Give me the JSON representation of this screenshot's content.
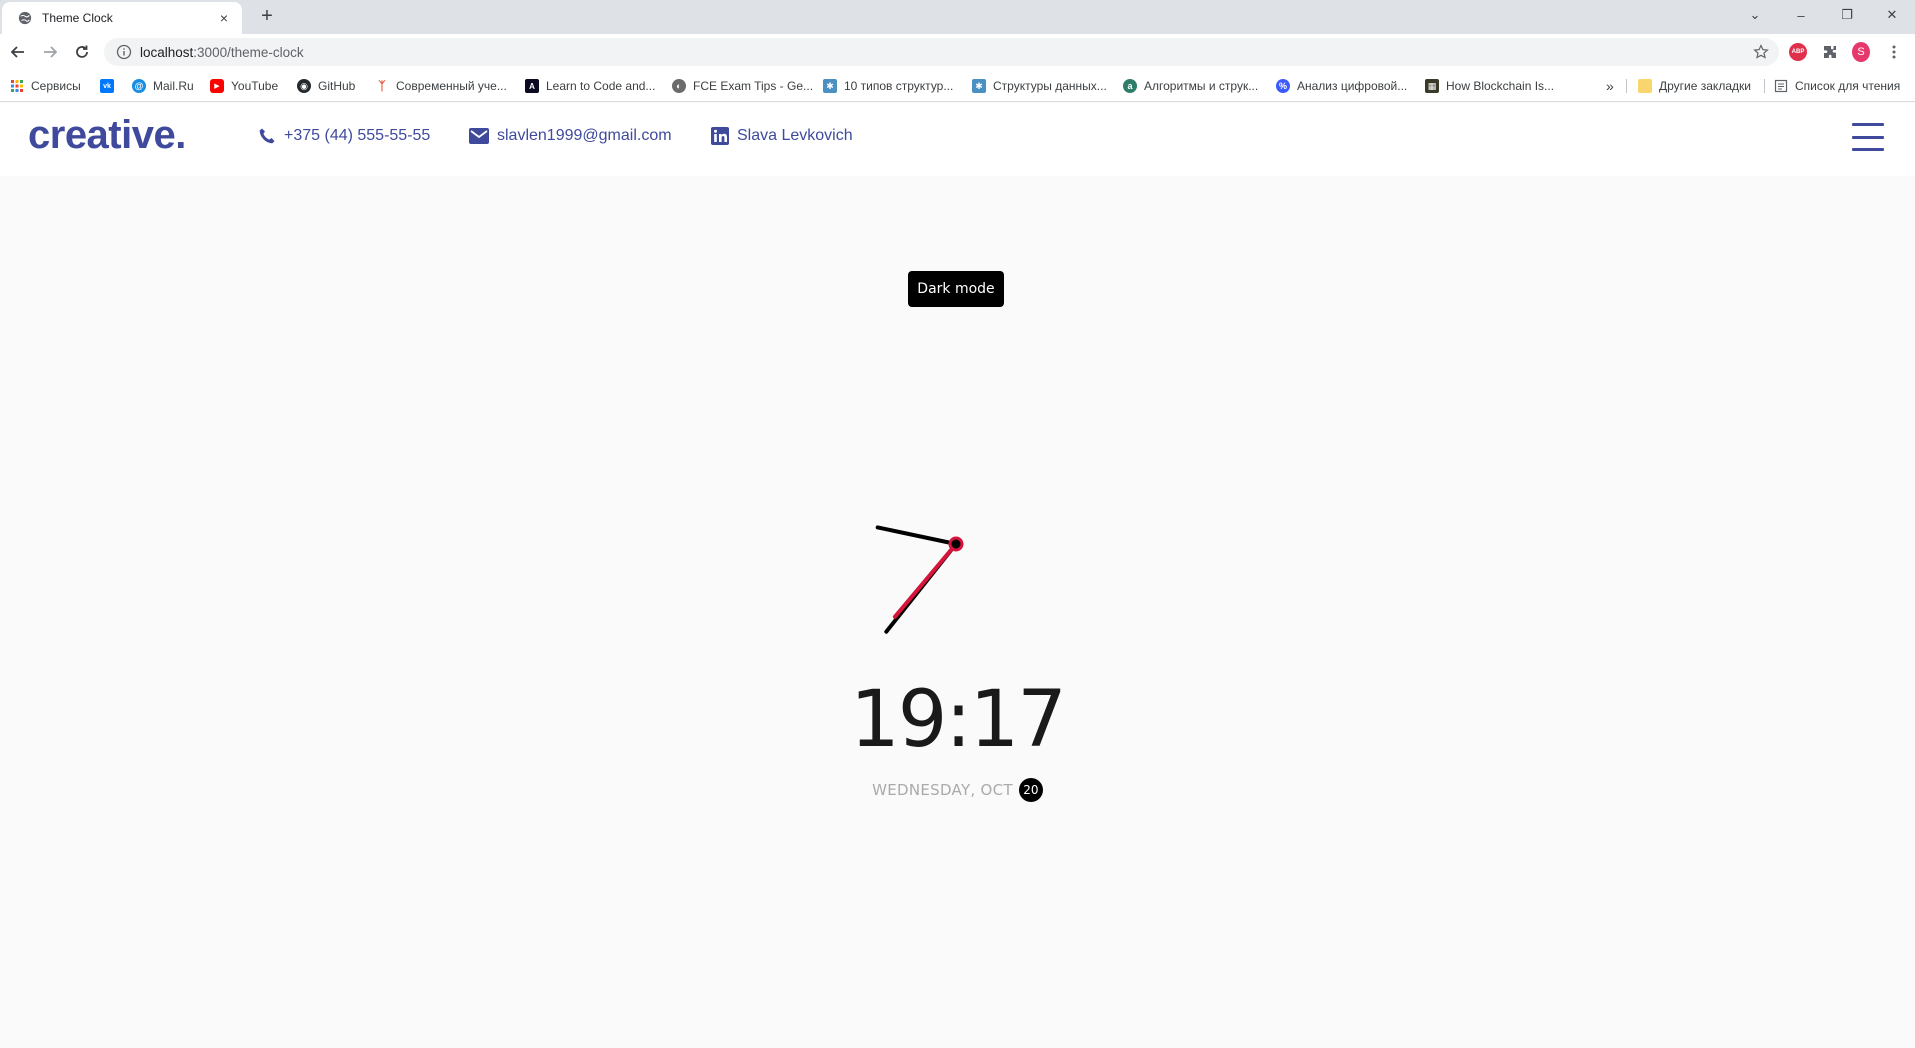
{
  "browser": {
    "tab": {
      "title": "Theme Clock",
      "close_glyph": "×",
      "favicon": "globe-icon"
    },
    "new_tab_glyph": "+",
    "window_controls": {
      "tab_search": "⌄",
      "minimize": "–",
      "restore": "❐",
      "close": "✕"
    },
    "address": {
      "host": "localhost",
      "path": ":3000/theme-clock"
    },
    "profile_initial": "S",
    "abp_label": "ABP"
  },
  "bookmarks": {
    "items": [
      {
        "label": "Сервисы",
        "icon": "apps-grid-icon",
        "color": "#e94235"
      },
      {
        "label": "",
        "icon": "vk-icon",
        "color": "#0077ff"
      },
      {
        "label": "Mail.Ru",
        "icon": "mailru-icon",
        "color": "#168de2"
      },
      {
        "label": "YouTube",
        "icon": "youtube-icon",
        "color": "#ff0000"
      },
      {
        "label": "GitHub",
        "icon": "github-icon",
        "color": "#24292e"
      },
      {
        "label": "Современный уче...",
        "icon": "javascript-info-icon",
        "color": "#e34c26"
      },
      {
        "label": "Learn to Code and...",
        "icon": "freecodecamp-icon",
        "color": "#0a0a23"
      },
      {
        "label": "FCE Exam Tips - Ge...",
        "icon": "fce-icon",
        "color": "#6b6b6b"
      },
      {
        "label": "10 типов структур...",
        "icon": "habr-icon-1",
        "color": "#4a90c2"
      },
      {
        "label": "Структуры данных...",
        "icon": "habr-icon-2",
        "color": "#4a90c2"
      },
      {
        "label": "Алгоритмы и струк...",
        "icon": "algo-icon",
        "color": "#2e7d6b"
      },
      {
        "label": "Анализ цифровой...",
        "icon": "analysis-icon",
        "color": "#3d5afe"
      },
      {
        "label": "How Blockchain Is...",
        "icon": "blockchain-icon",
        "color": "#3a3a2a"
      }
    ],
    "overflow": "»",
    "other_bookmarks": "Другие закладки",
    "reading_list": "Список для чтения"
  },
  "header": {
    "logo": "creative.",
    "phone": "+375 (44) 555-55-55",
    "email": "slavlen1999@gmail.com",
    "linkedin": "Slava Levkovich"
  },
  "toggle": {
    "label": "Dark mode"
  },
  "clock": {
    "time": "19:17",
    "date_text": "WEDNESDAY, OCT",
    "day": "20",
    "hour_value": 19,
    "minute_value": 17,
    "needle_color": "#d6143c",
    "hand_color": "#000000"
  },
  "colors": {
    "brand": "#3f4a9d",
    "page_bg": "#fafafa"
  }
}
